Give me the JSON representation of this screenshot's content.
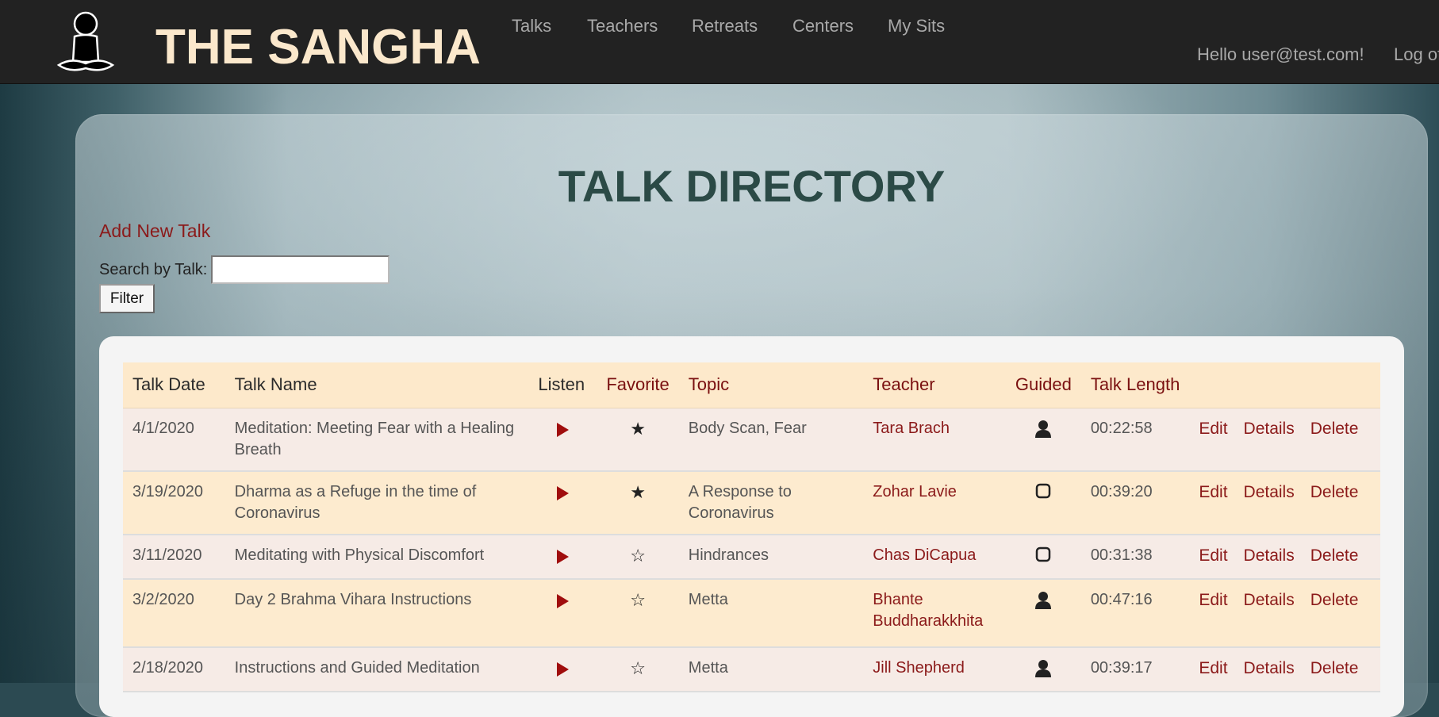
{
  "nav": {
    "brand": "THE SANGHA",
    "links": [
      "Talks",
      "Teachers",
      "Retreats",
      "Centers",
      "My Sits"
    ],
    "greeting": "Hello user@test.com!",
    "logout": "Log of"
  },
  "page": {
    "title": "TALK DIRECTORY",
    "add_link": "Add New Talk",
    "search_label": "Search by Talk:",
    "search_value": "",
    "filter_button": "Filter"
  },
  "table": {
    "headers": [
      "Talk Date",
      "Talk Name",
      "Listen",
      "Favorite",
      "Topic",
      "Teacher",
      "Guided",
      "Talk Length"
    ],
    "action_labels": {
      "edit": "Edit",
      "details": "Details",
      "delete": "Delete"
    },
    "rows": [
      {
        "date": "4/1/2020",
        "name": "Meditation: Meeting Fear with a Healing Breath",
        "favorite": "★",
        "topic": "Body Scan, Fear",
        "teacher": "Tara Brach",
        "guided": "person-icon",
        "length": "00:22:58"
      },
      {
        "date": "3/19/2020",
        "name": "Dharma as a Refuge in the time of Coronavirus",
        "favorite": "★",
        "topic": "A Response to Coronavirus",
        "teacher": "Zohar Lavie",
        "guided": "square-icon",
        "length": "00:39:20"
      },
      {
        "date": "3/11/2020",
        "name": "Meditating with Physical Discomfort",
        "favorite": "☆",
        "topic": "Hindrances",
        "teacher": "Chas DiCapua",
        "guided": "square-icon",
        "length": "00:31:38"
      },
      {
        "date": "3/2/2020",
        "name": "Day 2 Brahma Vihara Instructions",
        "favorite": "☆",
        "topic": "Metta",
        "teacher": "Bhante Buddharakkhita",
        "guided": "person-icon",
        "length": "00:47:16"
      },
      {
        "date": "2/18/2020",
        "name": "Instructions and Guided Meditation",
        "favorite": "☆",
        "topic": "Metta",
        "teacher": "Jill Shepherd",
        "guided": "person-icon",
        "length": "00:39:17"
      }
    ]
  },
  "colors": {
    "navbar_bg": "#222222",
    "brand": "#fbe8cc",
    "accent_red": "#8b1a1a",
    "title": "#2b4a46",
    "header_row": "#fde9cb"
  }
}
